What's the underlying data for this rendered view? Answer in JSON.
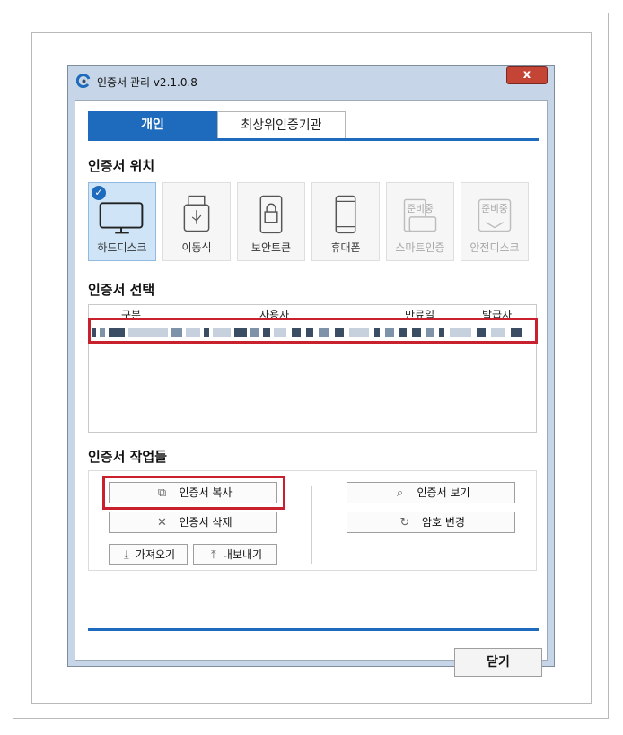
{
  "window": {
    "title": "인증서 관리 v2.1.0.8",
    "close_label": "x"
  },
  "tabs": [
    {
      "label": "개인",
      "selected": true
    },
    {
      "label": "최상위인증기관",
      "selected": false
    }
  ],
  "location": {
    "title": "인증서 위치",
    "items": [
      {
        "label": "하드디스크",
        "icon": "monitor-icon",
        "selected": true,
        "enabled": true
      },
      {
        "label": "이동식",
        "icon": "usb-icon",
        "selected": false,
        "enabled": true
      },
      {
        "label": "보안토큰",
        "icon": "lock-token-icon",
        "selected": false,
        "enabled": true
      },
      {
        "label": "휴대폰",
        "icon": "phone-icon",
        "selected": false,
        "enabled": true
      },
      {
        "label": "스마트인증",
        "icon": "smart-cert-icon",
        "badge": "준비중",
        "selected": false,
        "enabled": false
      },
      {
        "label": "안전디스크",
        "icon": "safe-disk-icon",
        "badge": "준비중",
        "selected": false,
        "enabled": false
      }
    ],
    "check_glyph": "✓"
  },
  "certificates": {
    "title": "인증서 선택",
    "columns": [
      "구분",
      "사용자",
      "만료일",
      "발급자"
    ]
  },
  "tasks": {
    "title": "인증서 작업들",
    "copy": {
      "label": "인증서 복사",
      "icon": "copy-icon",
      "glyph": "⧉"
    },
    "delete": {
      "label": "인증서 삭제",
      "icon": "close-icon",
      "glyph": "✕"
    },
    "import": {
      "label": "가져오기",
      "icon": "download-icon",
      "glyph": "⤓"
    },
    "export": {
      "label": "내보내기",
      "icon": "upload-icon",
      "glyph": "⤒"
    },
    "view": {
      "label": "인증서 보기",
      "icon": "search-icon",
      "glyph": "⌕"
    },
    "change_pw": {
      "label": "암호 변경",
      "icon": "refresh-icon",
      "glyph": "↻"
    }
  },
  "footer": {
    "close_label": "닫기"
  },
  "colors": {
    "accent": "#1e6bbd",
    "highlight": "#c8202d"
  }
}
